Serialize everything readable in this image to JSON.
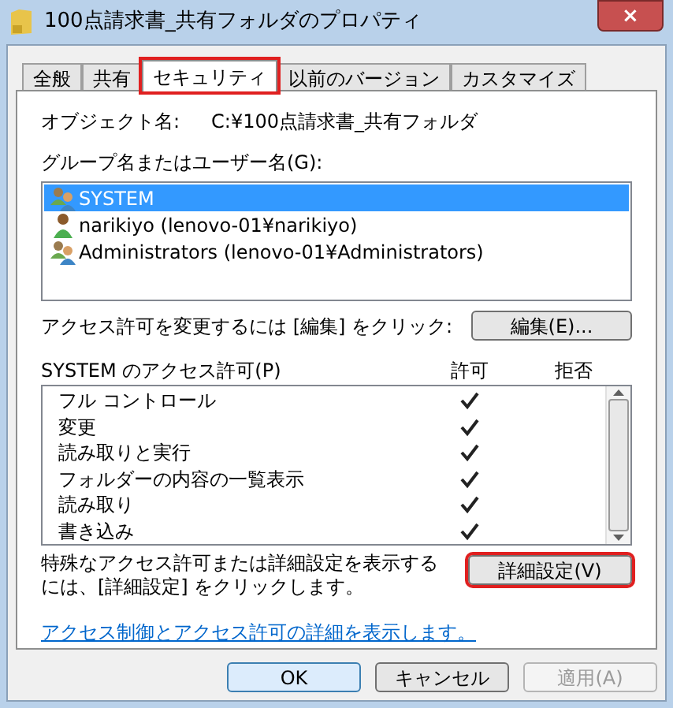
{
  "window": {
    "title": "100点請求書_共有フォルダのプロパティ",
    "close": "×"
  },
  "tabs": [
    {
      "label": "全般",
      "selected": false,
      "highlighted": false
    },
    {
      "label": "共有",
      "selected": false,
      "highlighted": false
    },
    {
      "label": "セキュリティ",
      "selected": true,
      "highlighted": true
    },
    {
      "label": "以前のバージョン",
      "selected": false,
      "highlighted": false
    },
    {
      "label": "カスタマイズ",
      "selected": false,
      "highlighted": false
    }
  ],
  "object": {
    "label": "オブジェクト名:",
    "value": "C:¥100点請求書_共有フォルダ"
  },
  "groups": {
    "label": "グループ名またはユーザー名(G):",
    "items": [
      {
        "name": "SYSTEM",
        "kind": "group",
        "selected": true
      },
      {
        "name": "narikiyo (lenovo-01¥narikiyo)",
        "kind": "user",
        "selected": false
      },
      {
        "name": "Administrators (lenovo-01¥Administrators)",
        "kind": "group",
        "selected": false
      }
    ]
  },
  "edit": {
    "label": "アクセス許可を変更するには [編集] をクリック:",
    "button": "編集(E)..."
  },
  "permissions": {
    "label": "SYSTEM のアクセス許可(P)",
    "allow_header": "許可",
    "deny_header": "拒否",
    "rows": [
      {
        "name": "フル コントロール",
        "allow": true,
        "deny": false
      },
      {
        "name": "変更",
        "allow": true,
        "deny": false
      },
      {
        "name": "読み取りと実行",
        "allow": true,
        "deny": false
      },
      {
        "name": "フォルダーの内容の一覧表示",
        "allow": true,
        "deny": false
      },
      {
        "name": "読み取り",
        "allow": true,
        "deny": false
      },
      {
        "name": "書き込み",
        "allow": true,
        "deny": false
      }
    ]
  },
  "advanced": {
    "text": "特殊なアクセス許可または詳細設定を表示するには、[詳細設定] をクリックします。",
    "button": "詳細設定(V)",
    "highlighted": true
  },
  "link": "アクセス制御とアクセス許可の詳細を表示します。",
  "buttons": [
    {
      "label": "OK",
      "kind": "default",
      "disabled": false
    },
    {
      "label": "キャンセル",
      "kind": "normal",
      "disabled": false
    },
    {
      "label": "適用(A)",
      "kind": "normal",
      "disabled": true
    }
  ]
}
